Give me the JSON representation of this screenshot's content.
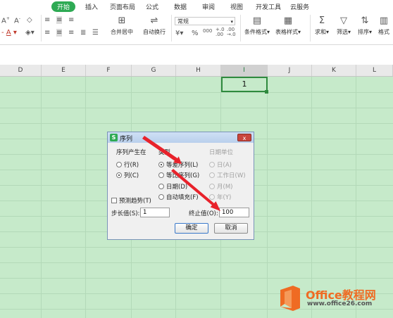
{
  "ribbon": {
    "tabs": [
      {
        "label": "开始",
        "active": true
      },
      {
        "label": "插入"
      },
      {
        "label": "页面布局"
      },
      {
        "label": "公式"
      },
      {
        "label": "数据"
      },
      {
        "label": "审阅"
      },
      {
        "label": "视图"
      },
      {
        "label": "开发工具"
      },
      {
        "label": "云服务"
      }
    ],
    "buttons": {
      "merge_center": "合并居中",
      "auto_wrap": "自动换行",
      "conditional_format": "条件格式",
      "table_style": "表格样式",
      "sum": "求和",
      "filter": "筛选",
      "sort": "排序",
      "format": "格式"
    },
    "number_format": "常规",
    "percent_symbol": "%",
    "thousands": "000",
    "dec_increase": "+.0\n.00",
    "dec_decrease": ".00\n→.0"
  },
  "grid": {
    "columns": [
      "D",
      "E",
      "F",
      "G",
      "H",
      "I",
      "J",
      "K",
      "L"
    ],
    "selected_column": "I",
    "active_cell_value": "1"
  },
  "dialog": {
    "title": "序列",
    "close_label": "x",
    "series_in_label": "序列产生在",
    "series_in_options": [
      {
        "label": "行(R)",
        "checked": false
      },
      {
        "label": "列(C)",
        "checked": true
      }
    ],
    "type_label": "类型",
    "type_options": [
      {
        "label": "等差序列(L)",
        "checked": true
      },
      {
        "label": "等比序列(G)",
        "checked": false
      },
      {
        "label": "日期(D)",
        "checked": false
      },
      {
        "label": "自动填充(F)",
        "checked": false
      }
    ],
    "date_unit_label": "日期单位",
    "date_unit_options": [
      {
        "label": "日(A)",
        "checked": true
      },
      {
        "label": "工作日(W)",
        "checked": false
      },
      {
        "label": "月(M)",
        "checked": false
      },
      {
        "label": "年(Y)",
        "checked": false
      }
    ],
    "trend_label": "预测趋势(T)",
    "step_label": "步长值(S):",
    "step_value": "1",
    "stop_label": "终止值(O):",
    "stop_value": "100",
    "ok_label": "确定",
    "cancel_label": "取消"
  },
  "watermark": {
    "title": "Office教程网",
    "url": "www.office26.com"
  },
  "colors": {
    "accent": "#2eaa54",
    "sheet_bg": "#c6eaca",
    "arrow": "#e8222b",
    "watermark": "#ef6b23"
  }
}
